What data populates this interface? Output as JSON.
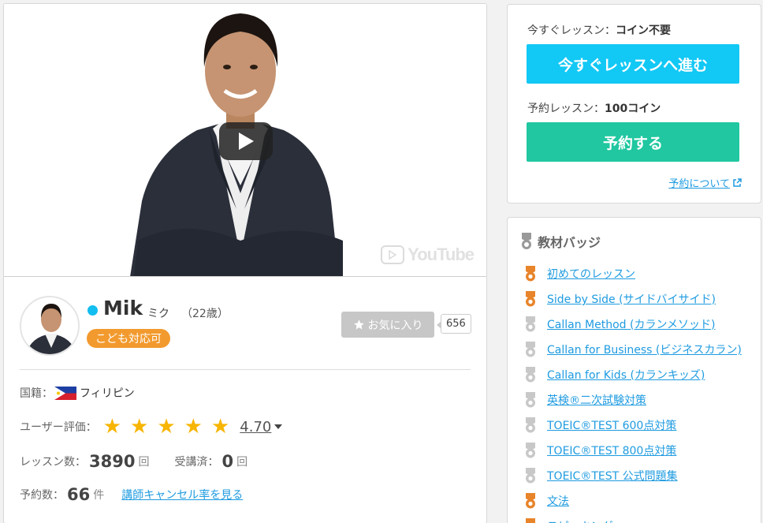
{
  "video": {
    "watermark": "YouTube"
  },
  "teacher": {
    "name": "Mik",
    "kana": "ミク",
    "age": "（22歳）",
    "kids_badge": "こども対応可",
    "favorite_label": "お気に入り",
    "favorite_count": "656",
    "nationality_label": "国籍：",
    "nationality": "フィリピン",
    "rating_label": "ユーザー評価：",
    "rating": "4.70",
    "stars": 5,
    "lessons_label": "レッスン数：",
    "lessons": "3890",
    "lessons_unit": "回",
    "taken_label": "受講済：",
    "taken": "0",
    "taken_unit": "回",
    "reservations_label": "予約数：",
    "reservations": "66",
    "reservations_unit": "件",
    "cancel_link": "講師キャンセル率を見る"
  },
  "lesson": {
    "now_label": "今すぐレッスン：",
    "now_cost": "コイン不要",
    "now_button": "今すぐレッスンへ進む",
    "reserve_label": "予約レッスン：",
    "reserve_cost": "100コイン",
    "reserve_button": "予約する",
    "about_link": "予約について"
  },
  "badges": {
    "title": "教材バッジ",
    "items": [
      {
        "label": "初めてのレッスン",
        "earned": true
      },
      {
        "label": "Side by Side (サイドバイサイド)",
        "earned": true
      },
      {
        "label": "Callan Method (カランメソッド)",
        "earned": false
      },
      {
        "label": "Callan for Business (ビジネスカラン)",
        "earned": false
      },
      {
        "label": "Callan for Kids (カランキッズ)",
        "earned": false
      },
      {
        "label": "英検®二次試験対策",
        "earned": false
      },
      {
        "label": "TOEIC®TEST 600点対策",
        "earned": false
      },
      {
        "label": "TOEIC®TEST 800点対策",
        "earned": false
      },
      {
        "label": "TOEIC®TEST 公式問題集",
        "earned": false
      },
      {
        "label": "文法",
        "earned": true
      },
      {
        "label": "スピーキング",
        "earned": true
      }
    ]
  },
  "colors": {
    "now_button": "#12c8f5",
    "reserve_button": "#20c7a0",
    "kids_badge": "#f29a2e",
    "link": "#1e9be0",
    "online": "#12bdf0",
    "badge_earned": "#e8842a",
    "badge_unearned": "#c8c8c8"
  }
}
